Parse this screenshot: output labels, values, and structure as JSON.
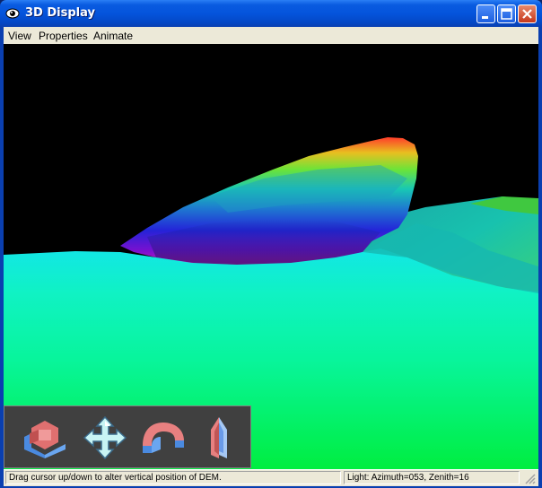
{
  "window": {
    "title": "3D Display"
  },
  "menu": {
    "items": [
      "View",
      "Properties",
      "Animate"
    ]
  },
  "navigation": {
    "tools": [
      {
        "icon": "rotate-icon"
      },
      {
        "icon": "pan-icon"
      },
      {
        "icon": "tilt-icon"
      },
      {
        "icon": "zoom-icon"
      }
    ]
  },
  "status": {
    "hint": "Drag cursor up/down to alter vertical position of DEM.",
    "light": "Light: Azimuth=053, Zenith=16"
  },
  "colors": {
    "title_bar": "#0454dc",
    "menu_bg": "#ece9d8",
    "sky": "#000000",
    "terrain_low": "#00ff80",
    "terrain_high": "#ff0000"
  }
}
